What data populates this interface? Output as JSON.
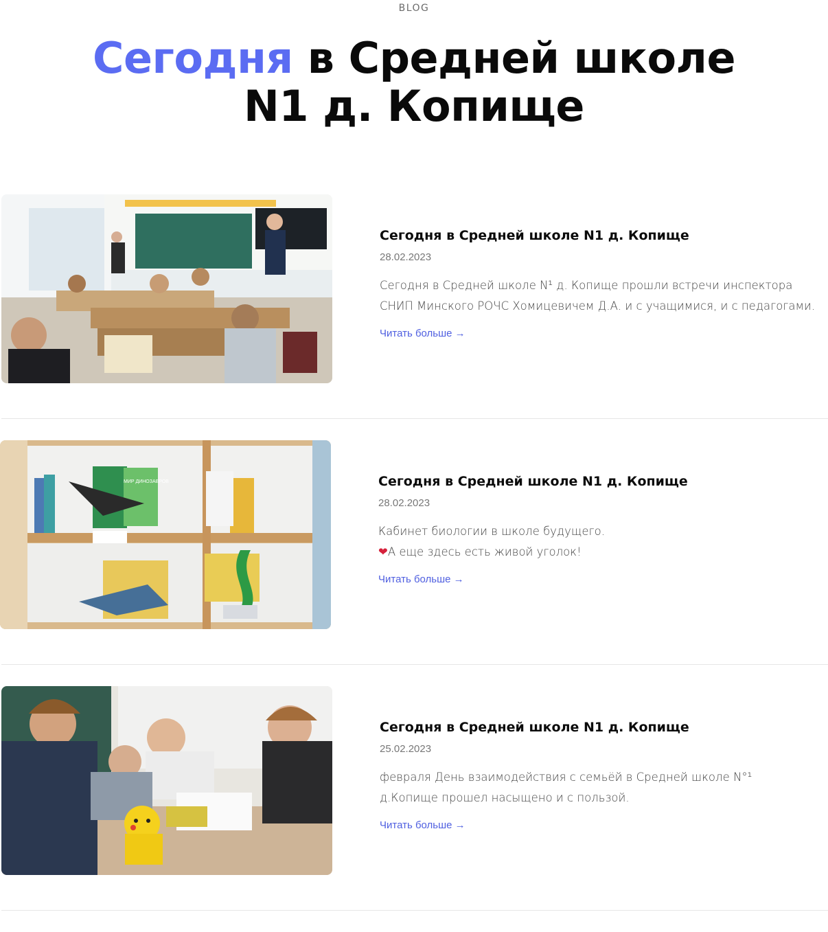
{
  "header": {
    "eyebrow": "BLOG",
    "title_accent": "Сегодня",
    "title_rest_line1": " в Средней школе",
    "title_line2": "N1 д. Копище",
    "accent_color": "#5b6cf2"
  },
  "posts": [
    {
      "title": "Сегодня в Средней школе N1 д. Копище",
      "date": "28.02.2023",
      "excerpt": [
        "Сегодня в Средней школе N¹ д. Копище прошли встречи инспектора",
        "СНИП Минского РОЧС Хомицевичем Д.А. и с учащимися, и с педагогами."
      ],
      "read_more": "Читать больше →",
      "image_alt": "classroom-photo"
    },
    {
      "title": "Сегодня в Средней школе N1 д. Копище",
      "date": "28.02.2023",
      "excerpt": [
        "Кабинет биологии в школе будущего.",
        "А еще здесь есть живой уголок!"
      ],
      "read_more": "Читать больше →",
      "image_alt": "biology-shelf-photo",
      "book_label": "МИР ДИНОЗАВРОВ"
    },
    {
      "title": "Сегодня в Средней школе N1 д. Копище",
      "date": "25.02.2023",
      "excerpt": [
        "февраля День взаимодействия с семьёй в Средней школе N°¹",
        "д.Копище прошел насыщено и с пользой."
      ],
      "read_more": "Читать больше →",
      "image_alt": "students-table-photo"
    }
  ],
  "icons": {
    "heart": "heart-icon",
    "arrow": "arrow-right-icon"
  }
}
